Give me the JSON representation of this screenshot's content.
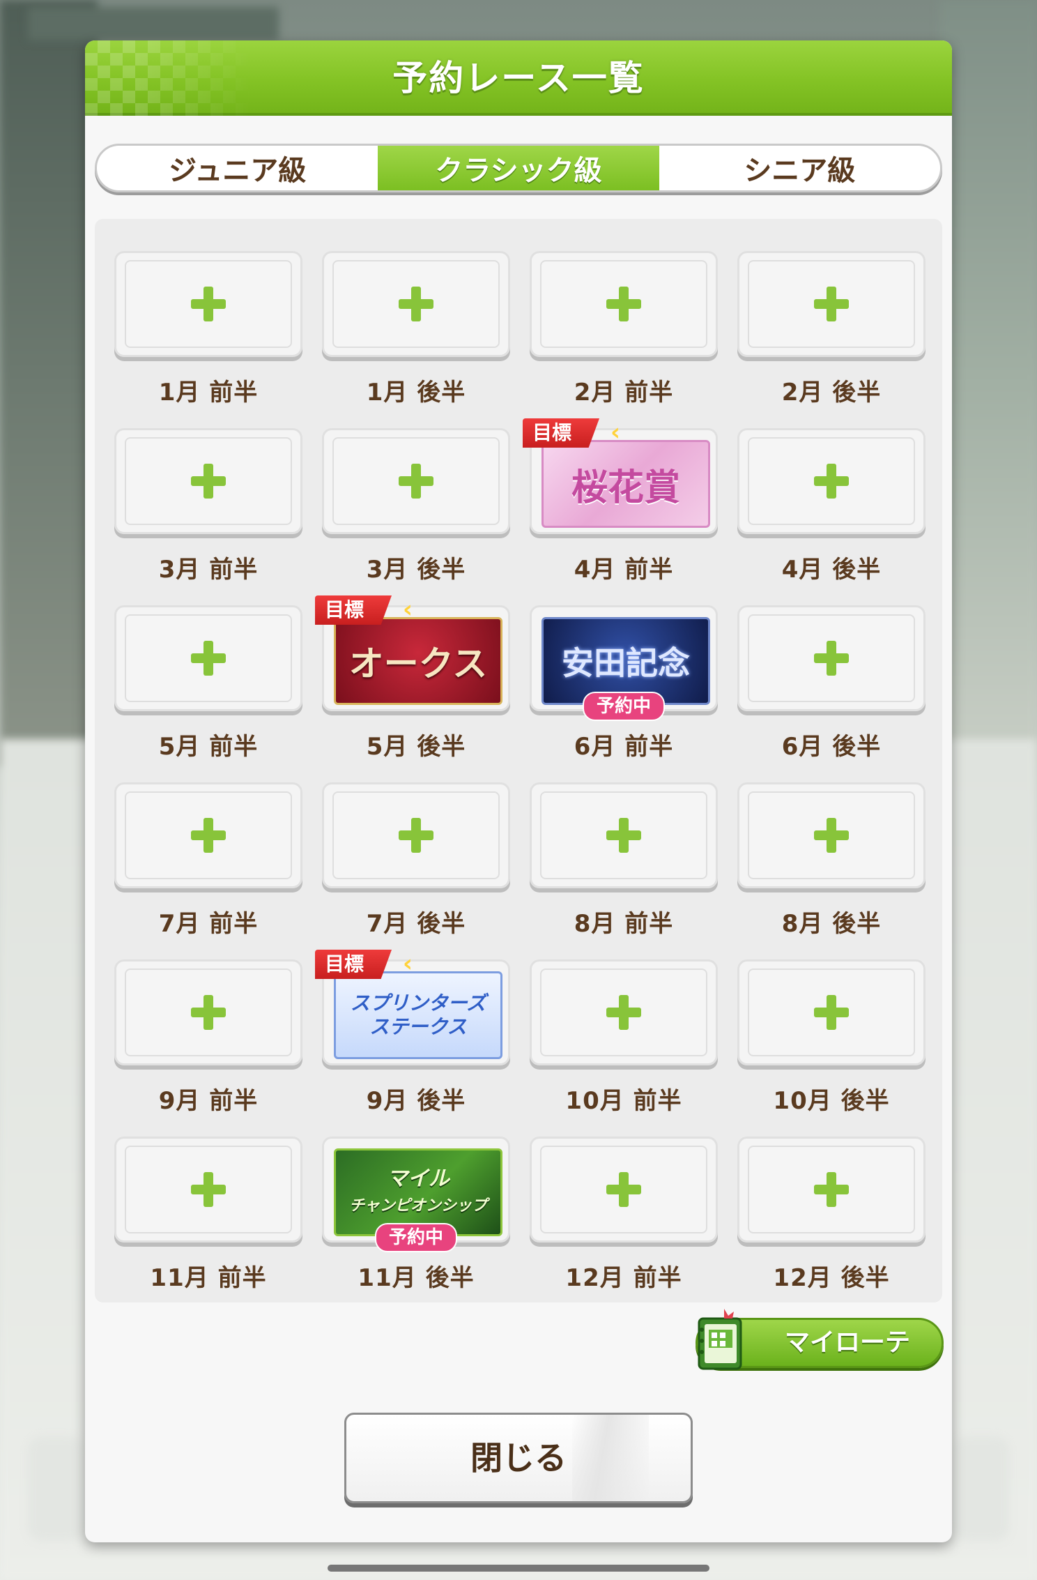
{
  "dialog": {
    "title": "予約レース一覧",
    "close_label": "閉じる",
    "myrote_label": "マイローテ"
  },
  "tabs": [
    {
      "label": "ジュニア級",
      "active": false
    },
    {
      "label": "クラシック級",
      "active": true
    },
    {
      "label": "シニア級",
      "active": false
    }
  ],
  "tags": {
    "goal": "目標",
    "reserved": "予約中"
  },
  "slots": [
    {
      "label": "1月 前半",
      "race": ""
    },
    {
      "label": "1月 後半",
      "race": ""
    },
    {
      "label": "2月 前半",
      "race": ""
    },
    {
      "label": "2月 後半",
      "race": ""
    },
    {
      "label": "3月 前半",
      "race": ""
    },
    {
      "label": "3月 後半",
      "race": ""
    },
    {
      "label": "4月 前半",
      "race": "桜花賞",
      "goal": true
    },
    {
      "label": "4月 後半",
      "race": ""
    },
    {
      "label": "5月 前半",
      "race": ""
    },
    {
      "label": "5月 後半",
      "race": "オークス",
      "goal": true
    },
    {
      "label": "6月 前半",
      "race": "安田記念",
      "reserved": true
    },
    {
      "label": "6月 後半",
      "race": ""
    },
    {
      "label": "7月 前半",
      "race": ""
    },
    {
      "label": "7月 後半",
      "race": ""
    },
    {
      "label": "8月 前半",
      "race": ""
    },
    {
      "label": "8月 後半",
      "race": ""
    },
    {
      "label": "9月 前半",
      "race": ""
    },
    {
      "label": "9月 後半",
      "race_line1": "スプリンターズ",
      "race_line2": "ステークス",
      "goal": true
    },
    {
      "label": "10月 前半",
      "race": ""
    },
    {
      "label": "10月 後半",
      "race": ""
    },
    {
      "label": "11月 前半",
      "race": ""
    },
    {
      "label": "11月 後半",
      "race_line1": "マイル",
      "race_line2": "チャンピオンシップ",
      "reserved": true
    },
    {
      "label": "12月 前半",
      "race": ""
    },
    {
      "label": "12月 後半",
      "race": ""
    }
  ],
  "colors": {
    "accent_green": "#84c325",
    "label_brown": "#5a3a1f",
    "reserved_pink": "#e8437e",
    "goal_red": "#d42a2a"
  }
}
